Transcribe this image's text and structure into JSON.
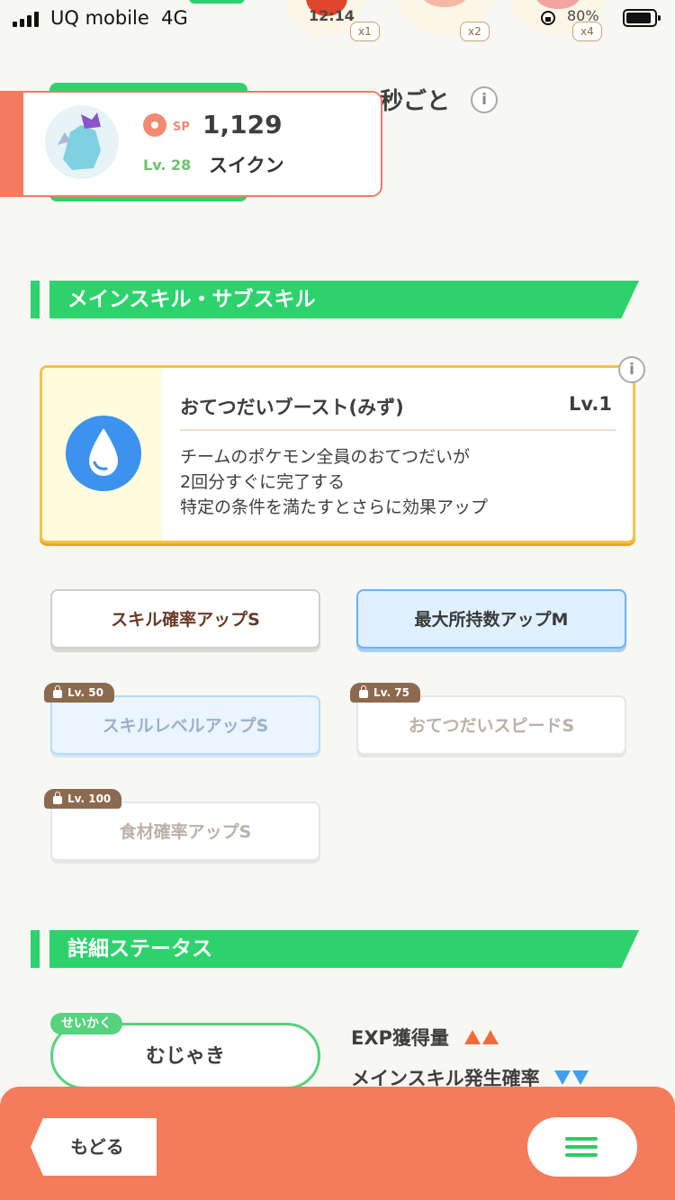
{
  "status_bar": {
    "carrier": "UQ mobile",
    "network": "4G",
    "time": "12:14",
    "battery": "80%"
  },
  "background_items": {
    "multipliers": [
      "x1",
      "x2",
      "x4"
    ],
    "interval_text": "秒ごと"
  },
  "pokemon": {
    "sp_label": "SP",
    "sp_value": "1,129",
    "level": "Lv. 28",
    "name": "スイクン"
  },
  "sections": {
    "skills_title": "メインスキル・サブスキル",
    "details_title": "詳細ステータス"
  },
  "main_skill": {
    "name": "おてつだいブースト(みず)",
    "level": "Lv.1",
    "description": "チームのポケモン全員のおてつだいが\n2回分すぐに完了する\n特定の条件を満たすとさらに効果アップ",
    "icon": "water-drop-icon",
    "color": "#3c92ee"
  },
  "sub_skills": [
    {
      "label": "スキル確率アップS",
      "locked": false,
      "unlock": ""
    },
    {
      "label": "最大所持数アップM",
      "locked": false,
      "unlock": ""
    },
    {
      "label": "スキルレベルアップS",
      "locked": true,
      "unlock": "Lv. 50"
    },
    {
      "label": "おてつだいスピードS",
      "locked": true,
      "unlock": "Lv. 75"
    },
    {
      "label": "食材確率アップS",
      "locked": true,
      "unlock": "Lv. 100"
    }
  ],
  "nature": {
    "label": "せいかく",
    "value": "むじゃき",
    "up_stat": "EXP獲得量",
    "down_stat": "メインスキル発生確率"
  },
  "bottom_bar": {
    "back_label": "もどる",
    "accent": "#f47b5c"
  }
}
